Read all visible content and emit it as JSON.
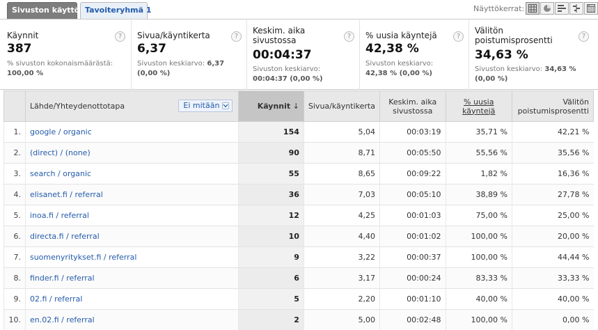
{
  "tabs": [
    {
      "label": "Sivuston käyttö",
      "active": true
    },
    {
      "label": "Tavoiteryhmä 1",
      "active": false
    }
  ],
  "view_label": "Näyttökerrat:",
  "view_icons": [
    "table-icon",
    "pie-chart-icon",
    "bar-chart-icon",
    "comparison-icon",
    "pivot-icon"
  ],
  "metrics": [
    {
      "label": "Käynnit",
      "value": "387",
      "sub_text": "% sivuston kokonaismäärästä:",
      "sub_value": "100,00 %"
    },
    {
      "label": "Sivua/käyntikerta",
      "value": "6,37",
      "sub_text": "Sivuston keskiarvo:",
      "sub_value": "6,37",
      "sub_value2": "(0,00 %)"
    },
    {
      "label": "Keskim. aika sivustossa",
      "value": "00:04:37",
      "sub_text": "Sivuston keskiarvo:",
      "sub_value": "00:04:37 (0,00 %)"
    },
    {
      "label": "% uusia käyntejä",
      "value": "42,38 %",
      "sub_text": "Sivuston keskiarvo:",
      "sub_value": "42,38 % (0,00 %)"
    },
    {
      "label": "Välitön poistumisprosentti",
      "value": "34,63 %",
      "sub_text": "Sivuston keskiarvo:",
      "sub_value": "34,63 %",
      "sub_value2": "(0,00 %)"
    }
  ],
  "table": {
    "headers": {
      "source": "Lähde/Yhteydenottotapa",
      "dimension_select": "Ei mitään",
      "visits": "Käynnit",
      "pages_per_visit": "Sivua/käyntikerta",
      "avg_time": "Keskim. aika sivustossa",
      "new_visits": "% uusia käyntejä",
      "bounce": "Välitön poistumisprosentti"
    },
    "rows": [
      {
        "idx": "1.",
        "source": "google / organic",
        "visits": "154",
        "ppv": "5,04",
        "time": "00:03:19",
        "new": "35,71 %",
        "bounce": "42,21 %"
      },
      {
        "idx": "2.",
        "source": "(direct) / (none)",
        "visits": "90",
        "ppv": "8,71",
        "time": "00:05:50",
        "new": "55,56 %",
        "bounce": "35,56 %"
      },
      {
        "idx": "3.",
        "source": "search / organic",
        "visits": "55",
        "ppv": "8,65",
        "time": "00:09:22",
        "new": "1,82 %",
        "bounce": "16,36 %"
      },
      {
        "idx": "4.",
        "source": "elisanet.fi / referral",
        "visits": "36",
        "ppv": "7,03",
        "time": "00:05:10",
        "new": "38,89 %",
        "bounce": "27,78 %"
      },
      {
        "idx": "5.",
        "source": "inoa.fi / referral",
        "visits": "12",
        "ppv": "4,25",
        "time": "00:01:03",
        "new": "75,00 %",
        "bounce": "25,00 %"
      },
      {
        "idx": "6.",
        "source": "directa.fi / referral",
        "visits": "10",
        "ppv": "4,40",
        "time": "00:01:02",
        "new": "100,00 %",
        "bounce": "20,00 %"
      },
      {
        "idx": "7.",
        "source": "suomenyritykset.fi / referral",
        "visits": "9",
        "ppv": "3,22",
        "time": "00:00:37",
        "new": "100,00 %",
        "bounce": "44,44 %"
      },
      {
        "idx": "8.",
        "source": "finder.fi / referral",
        "visits": "6",
        "ppv": "3,17",
        "time": "00:00:24",
        "new": "83,33 %",
        "bounce": "33,33 %"
      },
      {
        "idx": "9.",
        "source": "02.fi / referral",
        "visits": "5",
        "ppv": "2,20",
        "time": "00:01:10",
        "new": "40,00 %",
        "bounce": "40,00 %"
      },
      {
        "idx": "10.",
        "source": "en.02.fi / referral",
        "visits": "2",
        "ppv": "5,00",
        "time": "00:02:48",
        "new": "100,00 %",
        "bounce": "0,00 %"
      }
    ]
  }
}
